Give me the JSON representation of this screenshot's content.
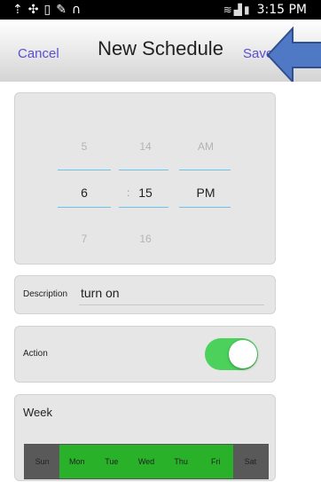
{
  "status_bar": {
    "left_icons": [
      "upload-icon",
      "usb-icon",
      "sim-icon",
      "edit-icon",
      "headset-icon"
    ],
    "right_icons": [
      "wifi-icon",
      "signal-icon",
      "battery-icon"
    ],
    "time": "3:15 PM"
  },
  "nav": {
    "cancel_label": "Cancel",
    "title": "New Schedule",
    "save_label": "Save"
  },
  "picker": {
    "hour": {
      "prev": "5",
      "selected": "6",
      "next": "7"
    },
    "minute": {
      "prev": "14",
      "selected": "15",
      "next": "16"
    },
    "ampm": {
      "prev": "AM",
      "selected": "PM"
    },
    "separator": ":"
  },
  "description": {
    "label": "Description",
    "value": "turn on"
  },
  "action": {
    "label": "Action",
    "enabled": true
  },
  "week": {
    "label": "Week",
    "days": [
      {
        "label": "Sun",
        "selected": false
      },
      {
        "label": "Mon",
        "selected": true
      },
      {
        "label": "Tue",
        "selected": true
      },
      {
        "label": "Wed",
        "selected": true
      },
      {
        "label": "Thu",
        "selected": true
      },
      {
        "label": "Fri",
        "selected": true
      },
      {
        "label": "Sat",
        "selected": false
      }
    ]
  },
  "colors": {
    "accent": "#5a4fd0",
    "toggle_on": "#4cd25c",
    "day_selected": "#29b229",
    "day_unselected": "#595959",
    "picker_line": "#69c3ea",
    "annotation_arrow": "#4f79c5"
  }
}
